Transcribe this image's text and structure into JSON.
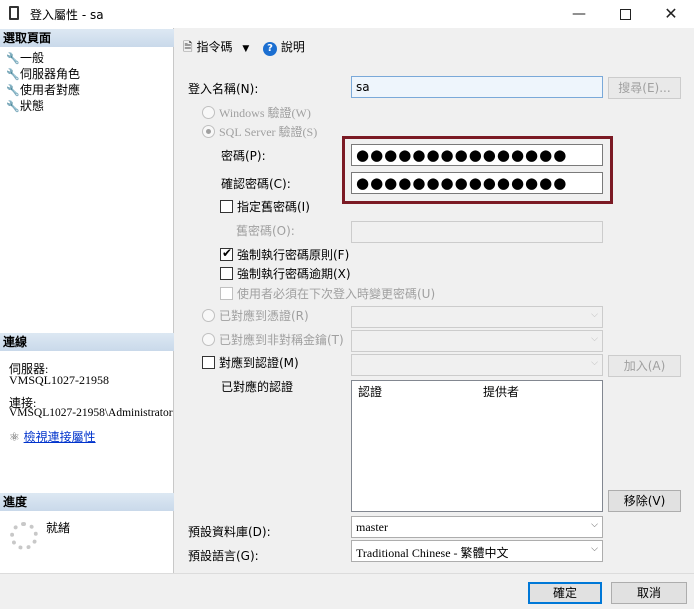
{
  "window": {
    "title": "登入屬性 - sa"
  },
  "left": {
    "select_page_header": "選取頁面",
    "pages": [
      {
        "label": "一般"
      },
      {
        "label": "伺服器角色"
      },
      {
        "label": "使用者對應"
      },
      {
        "label": "狀態"
      }
    ],
    "connection_header": "連線",
    "server_label": "伺服器:",
    "server_value": "VMSQL1027-21958",
    "connection_label": "連接:",
    "connection_value": "VMSQL1027-21958\\Administrator",
    "view_connection_properties": "檢視連接屬性",
    "progress_header": "進度",
    "progress_status": "就緒"
  },
  "toolbar": {
    "script_label": "指令碼",
    "help_label": "說明"
  },
  "form": {
    "login_name_label": "登入名稱(N):",
    "login_name_value": "sa",
    "search_button": "搜尋(E)...",
    "windows_auth_label": "Windows 驗證(W)",
    "sql_auth_label": "SQL Server 驗證(S)",
    "password_label": "密碼(P):",
    "password_value": "●●●●●●●●●●●●●●●",
    "confirm_password_label": "確認密碼(C):",
    "confirm_password_value": "●●●●●●●●●●●●●●●",
    "specify_old_password_label": "指定舊密碼(I)",
    "old_password_label": "舊密碼(O):",
    "enforce_policy_label": "強制執行密碼原則(F)",
    "enforce_expiration_label": "強制執行密碼逾期(X)",
    "must_change_label": "使用者必須在下次登入時變更密碼(U)",
    "mapped_to_cert_label": "已對應到憑證(R)",
    "mapped_to_asym_key_label": "已對應到非對稱金鑰(T)",
    "map_to_credential_label": "對應到認證(M)",
    "add_button": "加入(A)",
    "mapped_credentials_label": "已對應的認證",
    "grid_col_credential": "認證",
    "grid_col_provider": "提供者",
    "remove_button": "移除(V)",
    "default_database_label": "預設資料庫(D):",
    "default_database_value": "master",
    "default_language_label": "預設語言(G):",
    "default_language_value": "Traditional Chinese - 繁體中文"
  },
  "footer": {
    "ok_button": "確定",
    "cancel_button": "取消"
  },
  "colors": {
    "highlight_border": "#7b1a24",
    "section_header": "#c9d9ea",
    "link": "#0033cc"
  }
}
